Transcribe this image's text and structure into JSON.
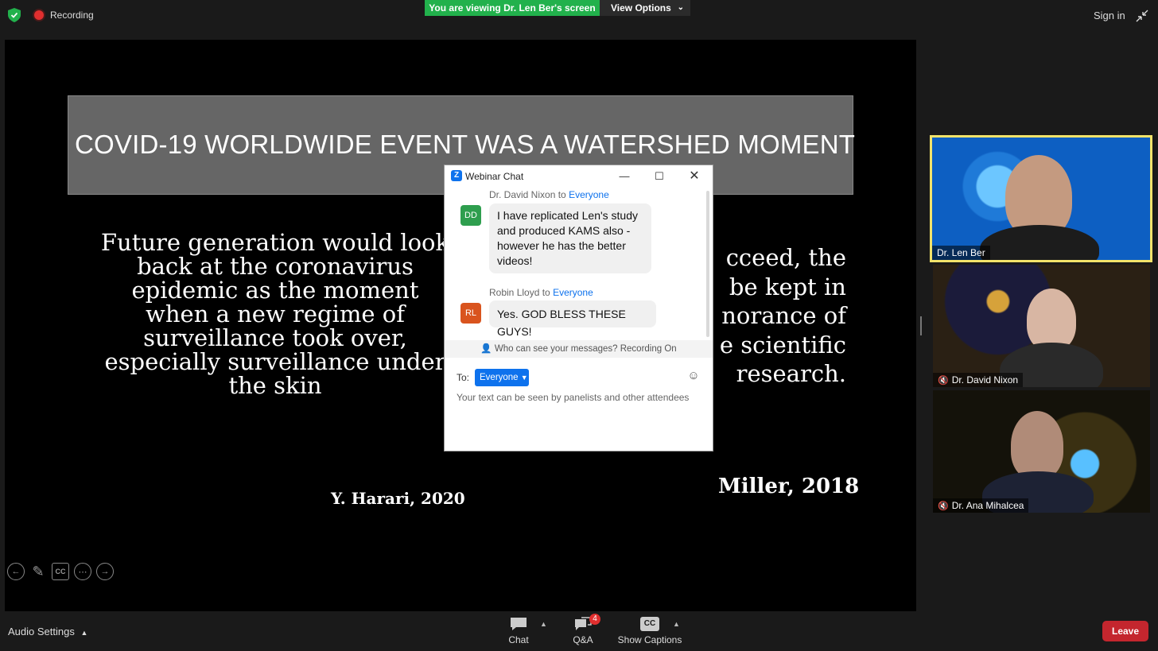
{
  "topbar": {
    "recording_label": "Recording",
    "viewing_banner": "You are viewing Dr. Len Ber's screen",
    "view_options_label": "View Options",
    "signin_label": "Sign in",
    "shield_icon": "shield-check-icon",
    "accent_green": "#22b14c"
  },
  "slide": {
    "title": "COVID-19 WORLDWIDE EVENT WAS A WATERSHED MOMENT",
    "left_quote_lines": [
      "Future generation would look",
      "back at the coronavirus",
      "epidemic as the moment",
      "when a new regime of",
      "surveillance took over,",
      "especially surveillance under",
      "the skin"
    ],
    "right_quote_lines": [
      "cceed, the",
      "be kept in",
      "norance of",
      "e scientific",
      "research."
    ],
    "citation_left": "Y. Harari, 2020",
    "citation_right": "Miller, 2018",
    "toolbar_cc": "CC"
  },
  "gallery": [
    {
      "name": "Dr. Len Ber",
      "muted": false,
      "active_speaker": true
    },
    {
      "name": "Dr. David Nixon",
      "muted": true,
      "active_speaker": false
    },
    {
      "name": "Dr. Ana Mihalcea",
      "muted": true,
      "active_speaker": false
    }
  ],
  "chat": {
    "window_title": "Webinar Chat",
    "logo_letter": "Z",
    "messages": [
      {
        "sender": "Dr. David Nixon",
        "to_word": "to",
        "recipient": "Everyone",
        "initials": "DD",
        "avatar_color": "#2e9e4e",
        "text": "I have replicated Len's  study and produced KAMS also - however he has the better videos!"
      },
      {
        "sender": "Robin Lloyd",
        "to_word": "to",
        "recipient": "Everyone",
        "initials": "RL",
        "avatar_color": "#d9541e",
        "text": "Yes. GOD BLESS THESE GUYS!"
      }
    ],
    "notice": "Who can see your messages? Recording On",
    "to_label": "To:",
    "to_value": "Everyone",
    "placeholder": "Your text can be seen by panelists and other attendees"
  },
  "bottombar": {
    "audio_settings": "Audio Settings",
    "chat_label": "Chat",
    "qa_label": "Q&A",
    "qa_badge": "4",
    "captions_label": "Show Captions",
    "captions_icon_text": "CC",
    "leave_label": "Leave",
    "leave_color": "#c4262e"
  }
}
